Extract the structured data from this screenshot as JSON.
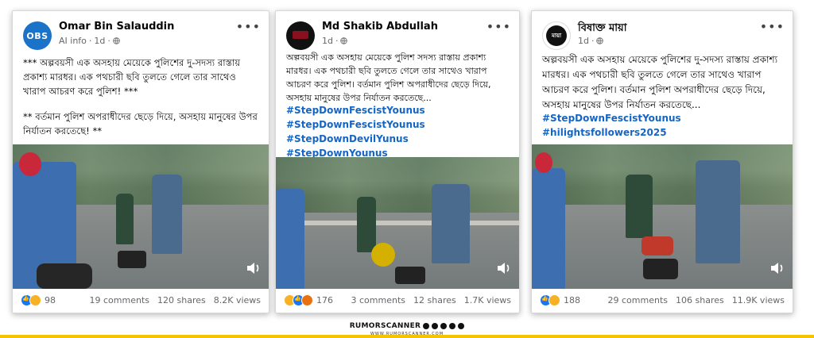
{
  "posts": [
    {
      "author": "Omar Bin Salauddin",
      "avatar_text": "OBS",
      "meta_prefix": "AI info",
      "time": "1d",
      "paragraphs": [
        "*** অল্পবয়সী এক অসহায় মেয়েকে পুলিশের দু-সদস্য রাস্তায় প্রকাশ্য মারধর। এক পথচারী ছবি তুলতে গেলে তার সাথেও খারাপ আচরণ করে পুলিশ! ***",
        "** বর্তমান পুলিশ অপরাধীদের ছেড়ে দিয়ে, অসহায় মানুষের উপর নির্যাতন করতেছে! **"
      ],
      "hashtags": [],
      "reaction_count": "98",
      "comments": "19 comments",
      "shares": "120 shares",
      "views": "8.2K views"
    },
    {
      "author": "Md Shakib Abdullah",
      "meta_prefix": "",
      "time": "1d",
      "paragraphs": [
        "অল্পবয়সী এক অসহায় মেয়েকে পুলিশ সদস্য রাস্তায় প্রকাশ্য মারধর। এক পথচারী ছবি তুলতে গেলে তার সাথেও খারাপ আচরণ করে পুলিশ। বর্তমান পুলিশ অপরাধীদের ছেড়ে দিয়ে, অসহায় মানুষের উপর নির্যাতন করতেছে..."
      ],
      "hashtags": [
        "#StepDownFescistYounus",
        "#StepDownFescistYounus",
        "#StepDownDevilYunus",
        "#StepDownYounus"
      ],
      "reaction_count": "176",
      "comments": "3 comments",
      "shares": "12 shares",
      "views": "1.7K views"
    },
    {
      "author": "বিষাক্ত মায়া",
      "avatar_text": "মায়া",
      "meta_prefix": "",
      "time": "1d",
      "paragraphs": [
        "অল্পবয়সী এক অসহায় মেয়েকে পুলিশের দু-সদস্য রাস্তায় প্রকাশ্য মারধর। এক পথচারী ছবি তুলতে গেলে তার সাথেও খারাপ আচরণ করে পুলিশ। বর্তমান পুলিশ অপরাধীদের ছেড়ে দিয়ে, অসহায় মানুষের উপর নির্যাতন করতেছে..."
      ],
      "hashtags": [
        "#StepDownFescistYounus",
        "#hilightsfollowers2025"
      ],
      "reaction_count": "188",
      "comments": "29 comments",
      "shares": "106 shares",
      "views": "11.9K views"
    }
  ],
  "icons": {
    "more": "more-options-icon",
    "privacy": "globe-icon",
    "sound": "speaker-icon",
    "reactions": [
      "like-icon",
      "haha-icon",
      "sad-icon",
      "angry-icon"
    ]
  },
  "brand": {
    "name": "RUMORSCANNER",
    "url": "WWW.RUMORSCANNER.COM"
  },
  "colors": {
    "hashtag": "#1566c4",
    "accent_bar": "#f2c500",
    "like": "#1877f2"
  }
}
